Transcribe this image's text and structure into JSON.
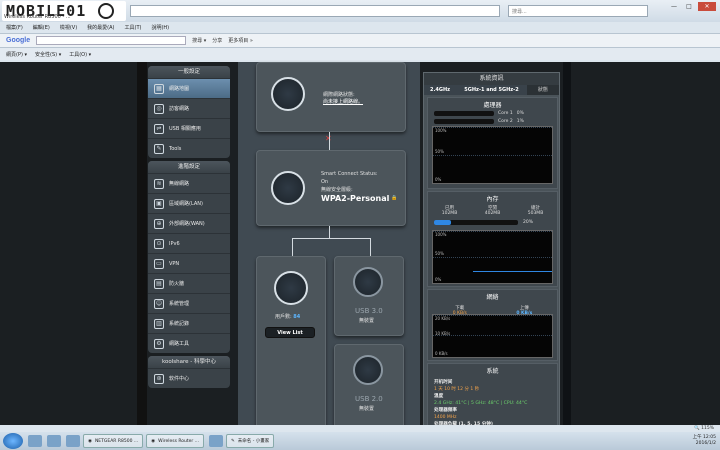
{
  "browser": {
    "logo": "MOBILE01",
    "tab_title": "Wireless Router R8500 - ...",
    "search_placeholder": "搜尋...",
    "window_buttons": [
      "—",
      "□",
      "✕"
    ],
    "menu": [
      "檔案(F)",
      "編輯(E)",
      "檢視(V)",
      "我的最愛(A)",
      "工具(T)",
      "說明(H)"
    ],
    "google_label": "Google",
    "google_tools": [
      "搜尋 ▾",
      "分享",
      "更多項目 »"
    ],
    "fav_tools": [
      "網頁(P) ▾",
      "安全性(S) ▾",
      "工具(O) ▾"
    ]
  },
  "sidebar": {
    "general_header": "一般設定",
    "general": [
      {
        "label": "網路地圖",
        "icon": "network-map-icon",
        "active": true
      },
      {
        "label": "訪客網路",
        "icon": "guest-network-icon"
      },
      {
        "label": "USB 相關應用",
        "icon": "usb-icon"
      },
      {
        "label": "Tools",
        "icon": "wrench-icon"
      }
    ],
    "advanced_header": "進階設定",
    "advanced": [
      {
        "label": "無線網路",
        "icon": "wireless-icon"
      },
      {
        "label": "區域網路(LAN)",
        "icon": "lan-icon"
      },
      {
        "label": "外部網路(WAN)",
        "icon": "wan-icon"
      },
      {
        "label": "IPv6",
        "icon": "ipv6-icon"
      },
      {
        "label": "VPN",
        "icon": "vpn-icon"
      },
      {
        "label": "防火牆",
        "icon": "firewall-icon"
      },
      {
        "label": "系統管理",
        "icon": "admin-icon"
      },
      {
        "label": "系統記錄",
        "icon": "log-icon"
      },
      {
        "label": "網路工具",
        "icon": "network-tools-icon"
      }
    ],
    "koolshare_header": "koolshare - 科學中心",
    "koolshare": [
      {
        "label": "软件中心",
        "icon": "software-center-icon"
      }
    ]
  },
  "map": {
    "internet_status_label": "網際網路狀態:",
    "internet_status_value": "尚未接上網路線。",
    "smart_connect_label": "Smart Connect Status:",
    "smart_connect_value": "On",
    "security_label": "無線安全層級:",
    "security_value": "WPA2-Personal",
    "clients_label": "用戶數:",
    "clients_value": "84",
    "view_list": "View List",
    "usb1_label": "USB 3.0",
    "usb1_status": "無裝置",
    "usb2_label": "USB 2.0",
    "usb2_status": "無裝置"
  },
  "status": {
    "title": "系統資訊",
    "tabs": [
      "2.4GHz",
      "5GHz-1 and 5GHz-2",
      "狀態"
    ],
    "cpu_header": "處理器",
    "cores": [
      {
        "label": "Core 1",
        "value": "0%"
      },
      {
        "label": "Core 2",
        "value": "1%"
      }
    ],
    "graph_labels": [
      "100%",
      "50%",
      "0%"
    ],
    "mem_header": "內存",
    "mem_cols": [
      {
        "label": "已用",
        "value": "102MB"
      },
      {
        "label": "空閒",
        "value": "402MB"
      },
      {
        "label": "總計",
        "value": "503MB"
      }
    ],
    "mem_percent": "20%",
    "mem_fraction": 0.2,
    "net_header": "網絡",
    "net_cols": [
      {
        "label": "下載",
        "value": "0 KB/s"
      },
      {
        "label": "上傳",
        "value": "0 KB/s"
      }
    ],
    "net_graph_labels": [
      "20 KB/s",
      "10 KB/s",
      "0 KB/s"
    ],
    "sys_header": "系統",
    "uptime_label": "开机时间",
    "uptime_value": "1 天 10 时 12 分 1 秒",
    "temp_label": "溫度",
    "temp_value": "2.4 GHz: 41°C | 5 GHz: 48°C | CPU: 44°C",
    "freq_label": "处理器频率",
    "freq_value": "1400 MHz",
    "load_label": "处理器负载 (1, 5, 15 分钟)"
  },
  "zoom": "115%",
  "taskbar": {
    "items": [
      "NETGEAR R8500 ...",
      "Wireless Router ...",
      "未命名 - 小畫家"
    ],
    "time": "上午 12:05",
    "date": "2016/1/2"
  }
}
